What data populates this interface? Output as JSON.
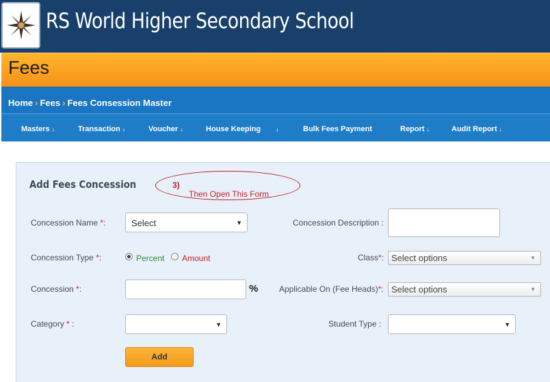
{
  "header": {
    "school_name": "RS World Higher Secondary School"
  },
  "title_bar": {
    "title": "Fees"
  },
  "breadcrumb": {
    "home": "Home",
    "sep": "›",
    "fees": "Fees",
    "current": "Fees Consession Master"
  },
  "menu": [
    {
      "label": "Masters"
    },
    {
      "label": "Transaction"
    },
    {
      "label": "Voucher"
    },
    {
      "label": "House Keeping"
    },
    {
      "label": "Bulk Fees Payment"
    },
    {
      "label": "Report"
    },
    {
      "label": "Audit Report"
    }
  ],
  "menu_caret": "↓",
  "form": {
    "title": "Add Fees Concession",
    "annotation": {
      "step": "3)",
      "text": "Then Open This Form"
    },
    "concession_name": {
      "label": "Concession Name",
      "req": "*",
      "colon": ":",
      "value": "Select"
    },
    "concession_description": {
      "label": "Concession Description :",
      "value": ""
    },
    "concession_type": {
      "label": "Concession Type",
      "req": "*",
      "colon": ":",
      "option_percent": "Percent",
      "option_amount": "Amount",
      "selected": "Percent"
    },
    "class": {
      "label": "Class",
      "req": "*",
      "colon": ":",
      "placeholder": "Select options"
    },
    "concession": {
      "label": "Concession",
      "req": "*",
      "colon": ":",
      "value": "",
      "unit": "%"
    },
    "applicable_on": {
      "label": "Applicable On (Fee Heads)",
      "req": "*",
      "colon": ":",
      "placeholder": "Select options"
    },
    "category": {
      "label": "Category",
      "req": "*",
      "colon": " :",
      "value": ""
    },
    "student_type": {
      "label": "Student Type :",
      "value": ""
    },
    "add_button": "Add"
  },
  "colors": {
    "header": "#19406a",
    "title_bar": "#f7931b",
    "nav": "#1a76c2",
    "accent_green": "#2e8b2e",
    "accent_red": "#c0202a"
  }
}
